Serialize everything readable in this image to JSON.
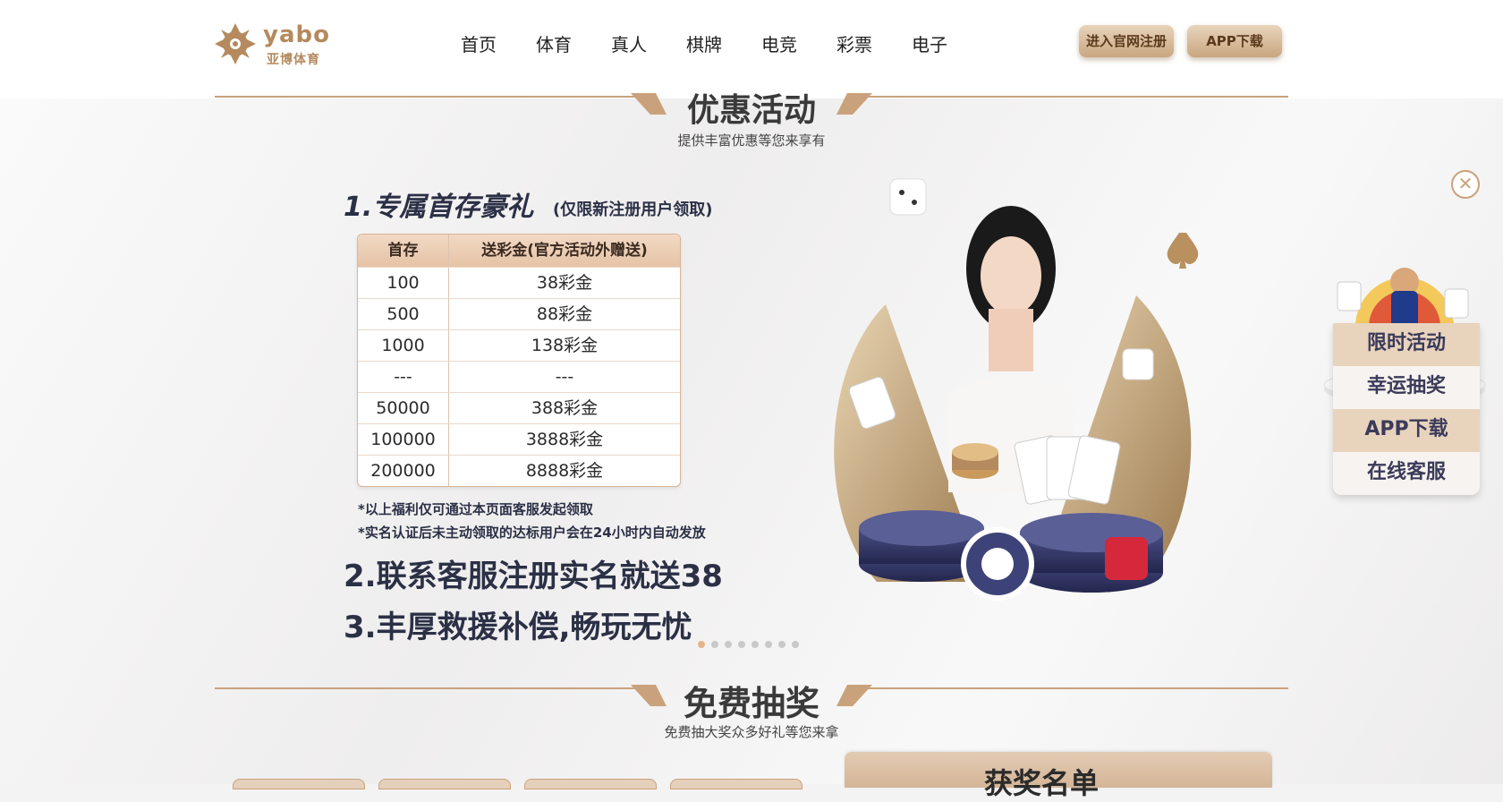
{
  "brand": {
    "logo_text": "yabo",
    "logo_sub": "亚博体育"
  },
  "nav": {
    "items": [
      "首页",
      "体育",
      "真人",
      "棋牌",
      "电竞",
      "彩票",
      "电子"
    ]
  },
  "header_buttons": {
    "register": "进入官网注册",
    "app": "APP下载"
  },
  "section1": {
    "title": "优惠活动",
    "subtitle": "提供丰富优惠等您来享有"
  },
  "promo": {
    "heading1": "1.专属首存豪礼",
    "heading1_note": "(仅限新注册用户领取)",
    "table": {
      "headers": [
        "首存",
        "送彩金(官方活动外赠送)"
      ],
      "rows": [
        [
          "100",
          "38彩金"
        ],
        [
          "500",
          "88彩金"
        ],
        [
          "1000",
          "138彩金"
        ],
        [
          "---",
          "---"
        ],
        [
          "50000",
          "388彩金"
        ],
        [
          "100000",
          "3888彩金"
        ],
        [
          "200000",
          "8888彩金"
        ]
      ]
    },
    "fine1": "*以上福利仅可通过本页面客服发起领取",
    "fine2": "*实名认证后未主动领取的达标用户会在24小时内自动发放",
    "heading2": "2.联系客服注册实名就送38",
    "heading3": "3.丰厚救援补偿,畅玩无忧"
  },
  "carousel": {
    "dot_count": 8,
    "active_index": 0
  },
  "float_panel": {
    "close_symbol": "✕",
    "items": [
      "限时活动",
      "幸运抽奖",
      "APP下载",
      "在线客服"
    ]
  },
  "section2": {
    "title": "免费抽奖",
    "subtitle": "免费抽大奖众多好礼等您来拿"
  },
  "winners": {
    "title": "获奖名单"
  },
  "colors": {
    "accent": "#c9a27c",
    "text_dark": "#2b3046"
  }
}
